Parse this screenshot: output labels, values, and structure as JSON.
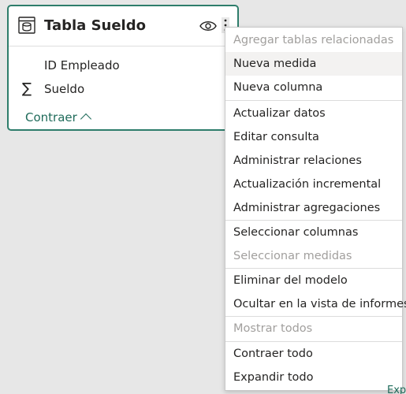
{
  "table_card": {
    "title": "Tabla Sueldo",
    "fields": [
      "ID Empleado",
      "Sueldo"
    ],
    "collapse_label": "Contraer",
    "border_color": "#2e7d6b",
    "icons": [
      "table-icon",
      "eye-icon",
      "more-options-icon",
      "sigma-icon",
      "chevron-up-icon"
    ]
  },
  "context_menu": {
    "items": [
      {
        "label": "Agregar tablas relacionadas",
        "disabled": true
      },
      {
        "label": "Nueva medida",
        "disabled": false,
        "hover": true
      },
      {
        "label": "Nueva columna",
        "disabled": false
      },
      {
        "label": "Actualizar datos",
        "disabled": false
      },
      {
        "label": "Editar consulta",
        "disabled": false
      },
      {
        "label": "Administrar relaciones",
        "disabled": false
      },
      {
        "label": "Actualización incremental",
        "disabled": false
      },
      {
        "label": "Administrar agregaciones",
        "disabled": false
      },
      {
        "label": "Seleccionar columnas",
        "disabled": false
      },
      {
        "label": "Seleccionar medidas",
        "disabled": true
      },
      {
        "label": "Eliminar del modelo",
        "disabled": false
      },
      {
        "label": "Ocultar en la vista de informes",
        "disabled": false
      },
      {
        "label": "Mostrar todos",
        "disabled": true
      },
      {
        "label": "Contraer todo",
        "disabled": false
      },
      {
        "label": "Expandir todo",
        "disabled": false
      }
    ]
  },
  "corner_fragment": "Exp"
}
